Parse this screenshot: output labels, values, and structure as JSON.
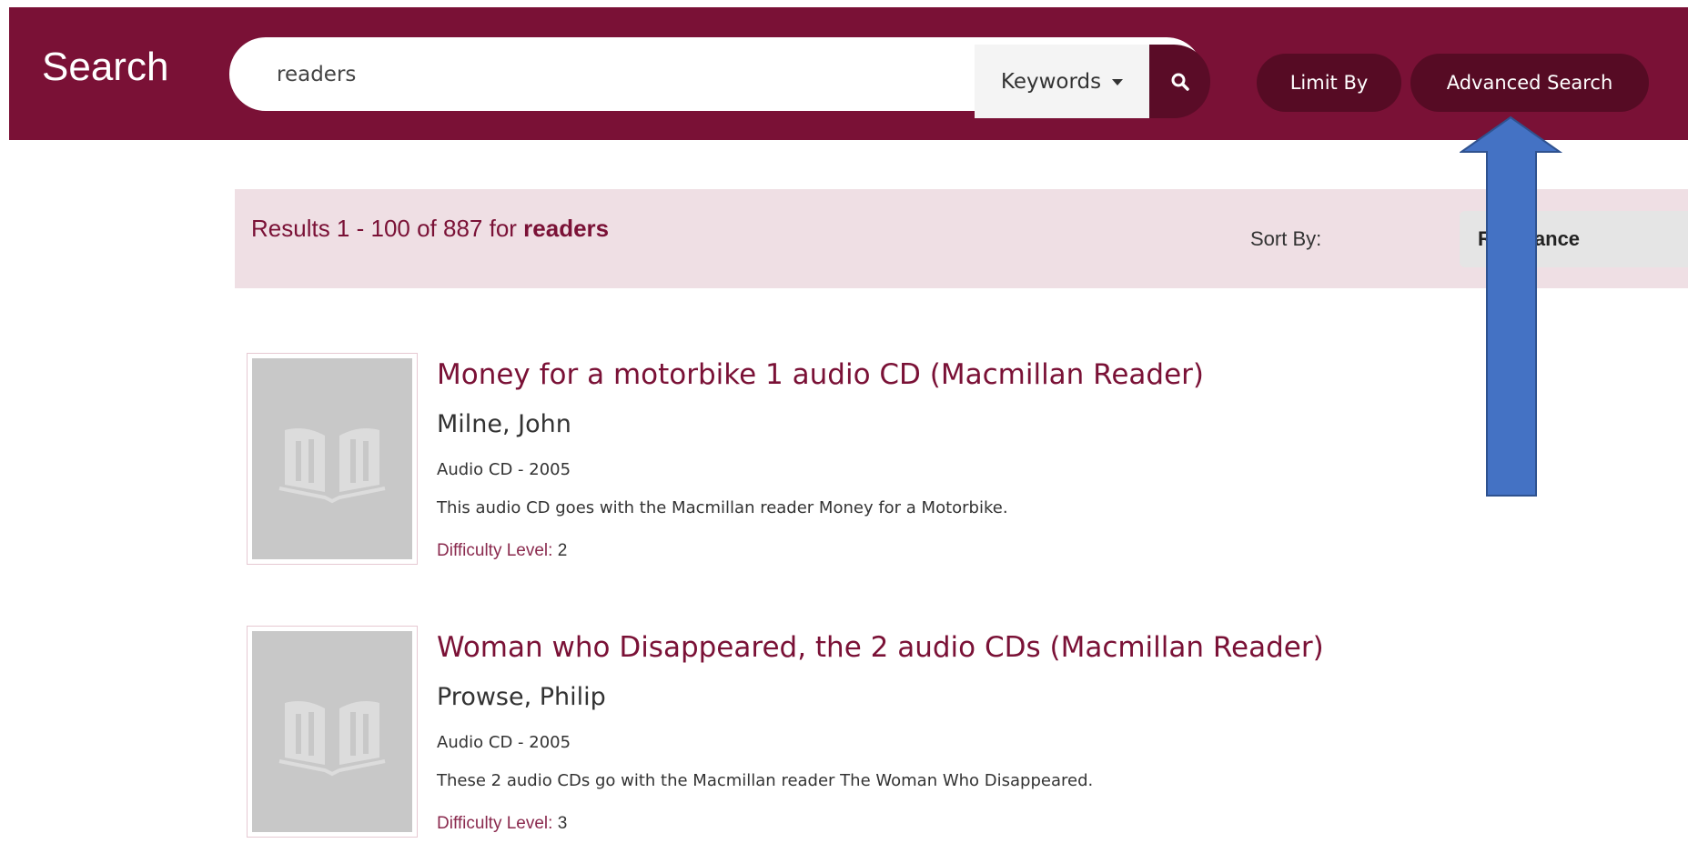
{
  "header": {
    "title": "Search",
    "search_value": "readers",
    "search_field_label": "Keywords",
    "search_icon": "search-icon",
    "limit_by_label": "Limit By",
    "advanced_search_label": "Advanced Search"
  },
  "results_bar": {
    "prefix": "Results 1 - 100 of 887 for ",
    "query": "readers",
    "sort_label": "Sort By:",
    "sort_value_prefix": "R",
    "sort_value_suffix": "ance"
  },
  "results": [
    {
      "title": "Money for a motorbike 1 audio CD (Macmillan Reader)",
      "author": "Milne, John",
      "format": "Audio CD - 2005",
      "description": "This audio CD goes with the Macmillan reader Money for a Motorbike.",
      "difficulty_label": "Difficulty Level:",
      "difficulty_value": "2",
      "thumbnail_icon": "book-icon"
    },
    {
      "title": "Woman who Disappeared, the 2 audio CDs (Macmillan Reader)",
      "author": "Prowse, Philip",
      "format": "Audio CD - 2005",
      "description": "These 2 audio CDs go with the Macmillan reader The Woman Who Disappeared.",
      "difficulty_label": "Difficulty Level:",
      "difficulty_value": "3",
      "thumbnail_icon": "book-icon"
    }
  ],
  "annotation": {
    "arrow_icon": "up-arrow-icon",
    "arrow_color": "#4472c4"
  },
  "colors": {
    "brand": "#7a1136",
    "results_bar_bg": "#efdfe4",
    "pill_bg": "#560b24"
  }
}
